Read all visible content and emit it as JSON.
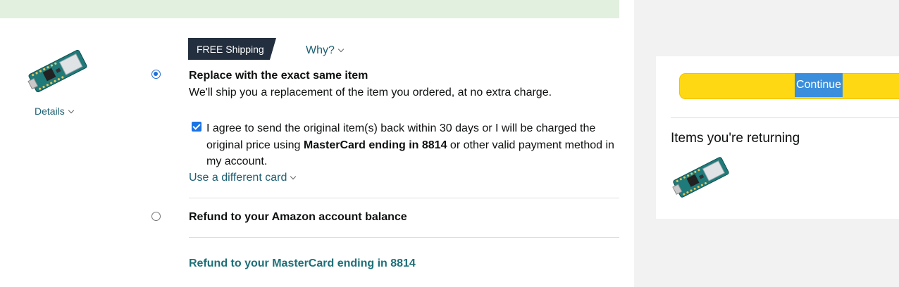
{
  "item": {
    "details_label": "Details"
  },
  "shipping": {
    "badge_label": "FREE Shipping",
    "why_label": "Why?"
  },
  "options": {
    "replace": {
      "title": "Replace with the exact same item",
      "description": "We'll ship you a replacement of the item you ordered, at no extra charge.",
      "selected": true
    },
    "agreement": {
      "text_before": "I agree to send the original item(s) back within 30 days or I will be charged the original price using ",
      "card_bold": "MasterCard ending in 8814",
      "text_after": " or other valid payment method in my account.",
      "checked": true
    },
    "different_card_label": "Use a different card",
    "refund_balance": {
      "title": "Refund to your Amazon account balance",
      "selected": false
    },
    "refund_card_label": "Refund to your MasterCard ending in 8814"
  },
  "summary": {
    "continue_label": "Continue",
    "items_title": "Items you're returning"
  },
  "colors": {
    "banner": "#e2f0e0",
    "link": "#1d5f72",
    "continue_button": "#ffd814",
    "badge": "#232f3e"
  }
}
